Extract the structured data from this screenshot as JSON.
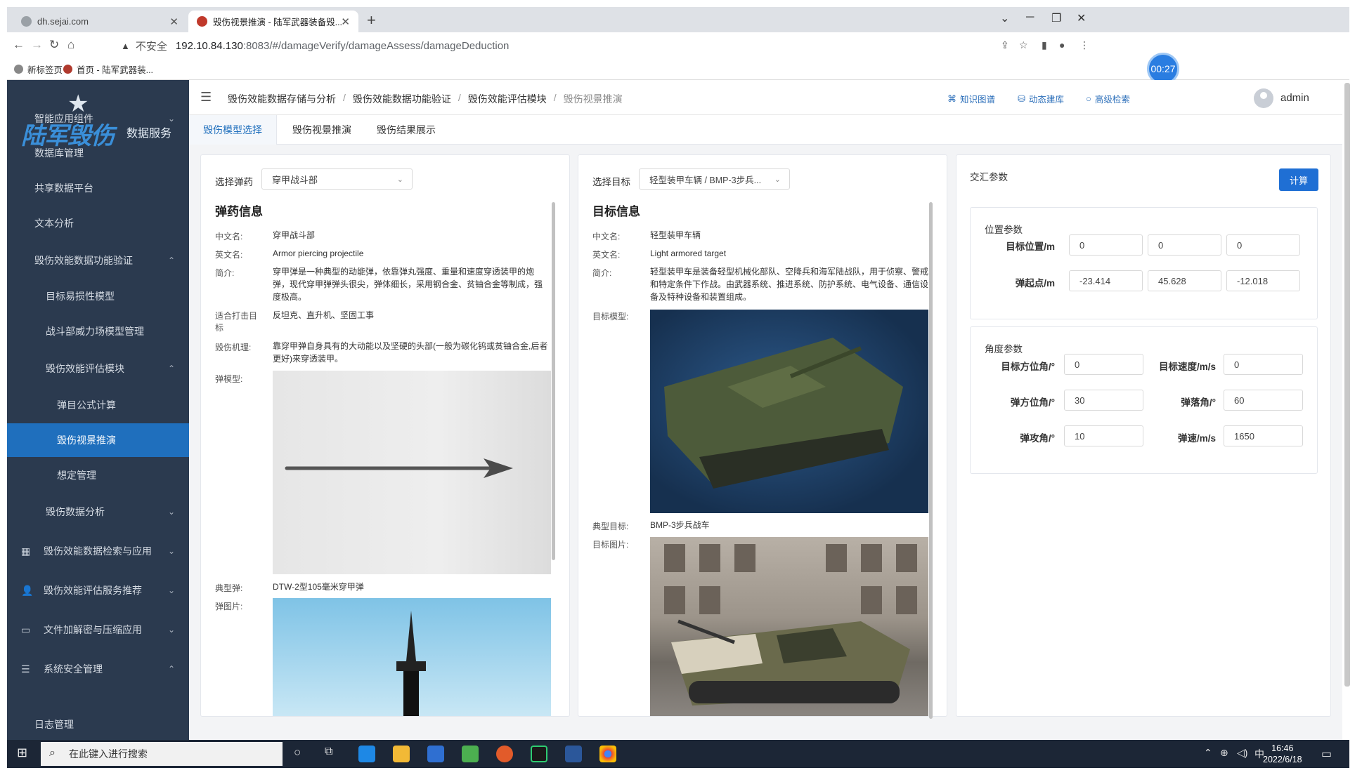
{
  "browser": {
    "tabs": [
      {
        "title": "dh.sejai.com"
      },
      {
        "title": "毁伤视景推演 - 陆军武器装备毁..."
      }
    ],
    "new_tab": "+",
    "url_warning": "不安全",
    "url_host": "192.10.84.130",
    "url_path": ":8083/#/damageVerify/damageAssess/damageDeduction",
    "bookmarks": [
      "新标签页",
      "首页 - 陆军武器装..."
    ]
  },
  "timer": "00:27",
  "sidebar": {
    "logo_main": "陆军毁伤",
    "logo_sub": "数据服务",
    "items": [
      {
        "label": "智能应用组件"
      },
      {
        "label": "数据库管理"
      },
      {
        "label": "共享数据平台"
      },
      {
        "label": "文本分析"
      },
      {
        "label": "毁伤效能数据功能验证"
      },
      {
        "label": "目标易损性模型"
      },
      {
        "label": "战斗部威力场模型管理"
      },
      {
        "label": "毁伤效能评估模块"
      },
      {
        "label": "弹目公式计算"
      },
      {
        "label": "毁伤视景推演"
      },
      {
        "label": "想定管理"
      },
      {
        "label": "毁伤数据分析"
      },
      {
        "label": "毁伤效能数据检索与应用"
      },
      {
        "label": "毁伤效能评估服务推荐"
      },
      {
        "label": "文件加解密与压缩应用"
      },
      {
        "label": "系统安全管理"
      },
      {
        "label": "日志管理"
      }
    ]
  },
  "header": {
    "breadcrumb": [
      "毁伤效能数据存储与分析",
      "毁伤效能数据功能验证",
      "毁伤效能评估模块",
      "毁伤视景推演"
    ],
    "links": [
      "知识图谱",
      "动态建库",
      "高级检索"
    ],
    "user": "admin"
  },
  "page_tabs": [
    "毁伤模型选择",
    "毁伤视景推演",
    "毁伤结果展示"
  ],
  "ammo": {
    "select_label": "选择弹药",
    "select_value": "穿甲战斗部",
    "title": "弹药信息",
    "fields": {
      "cn_key": "中文名:",
      "cn_val": "穿甲战斗部",
      "en_key": "英文名:",
      "en_val": "Armor piercing projectile",
      "intro_key": "简介:",
      "intro_val": "穿甲弹是一种典型的动能弹，依靠弹丸强度、重量和速度穿透装甲的炮弹，现代穿甲弹弹头很尖，弹体细长，采用钢合金、贫铀合金等制成，强度极高。",
      "target_key": "适合打击目标",
      "target_val": "反坦克、直升机、坚固工事",
      "mech_key": "毁伤机理:",
      "mech_val": "靠穿甲弹自身具有的大动能以及坚硬的头部(一般为碳化钨或贫铀合金,后者更好)来穿透装甲。",
      "model_key": "弹模型:",
      "typical_key": "典型弹:",
      "typical_val": "DTW-2型105毫米穿甲弹",
      "pic_key": "弹图片:"
    }
  },
  "target": {
    "select_label": "选择目标",
    "select_value": "轻型装甲车辆 / BMP-3步兵...",
    "title": "目标信息",
    "fields": {
      "cn_key": "中文名:",
      "cn_val": "轻型装甲车辆",
      "en_key": "英文名:",
      "en_val": "Light armored target",
      "intro_key": "简介:",
      "intro_val": "轻型装甲车是装备轻型机械化部队、空降兵和海军陆战队，用于侦察、警戒和特定条件下作战。由武器系统、推进系统、防护系统、电气设备、通信设备及特种设备和装置组成。",
      "model_key": "目标模型:",
      "typical_key": "典型目标:",
      "typical_val": "BMP-3步兵战车",
      "pic_key": "目标图片:"
    }
  },
  "params": {
    "title": "交汇参数",
    "calc": "计算",
    "position": {
      "title": "位置参数",
      "target_pos_label": "目标位置/m",
      "target_pos": [
        "0",
        "0",
        "0"
      ],
      "launch_label": "弹起点/m",
      "launch": [
        "-23.414",
        "45.628",
        "-12.018"
      ]
    },
    "angle": {
      "title": "角度参数",
      "target_az_label": "目标方位角/°",
      "target_az": "0",
      "target_speed_label": "目标速度/m/s",
      "target_speed": "0",
      "ammo_az_label": "弹方位角/°",
      "ammo_az": "30",
      "fall_label": "弹落角/°",
      "fall": "60",
      "attack_label": "弹攻角/°",
      "attack": "10",
      "speed_label": "弹速/m/s",
      "speed": "1650"
    }
  },
  "taskbar": {
    "search_placeholder": "在此键入进行搜索",
    "time": "16:46",
    "date": "2022/6/18",
    "ime": "中"
  }
}
